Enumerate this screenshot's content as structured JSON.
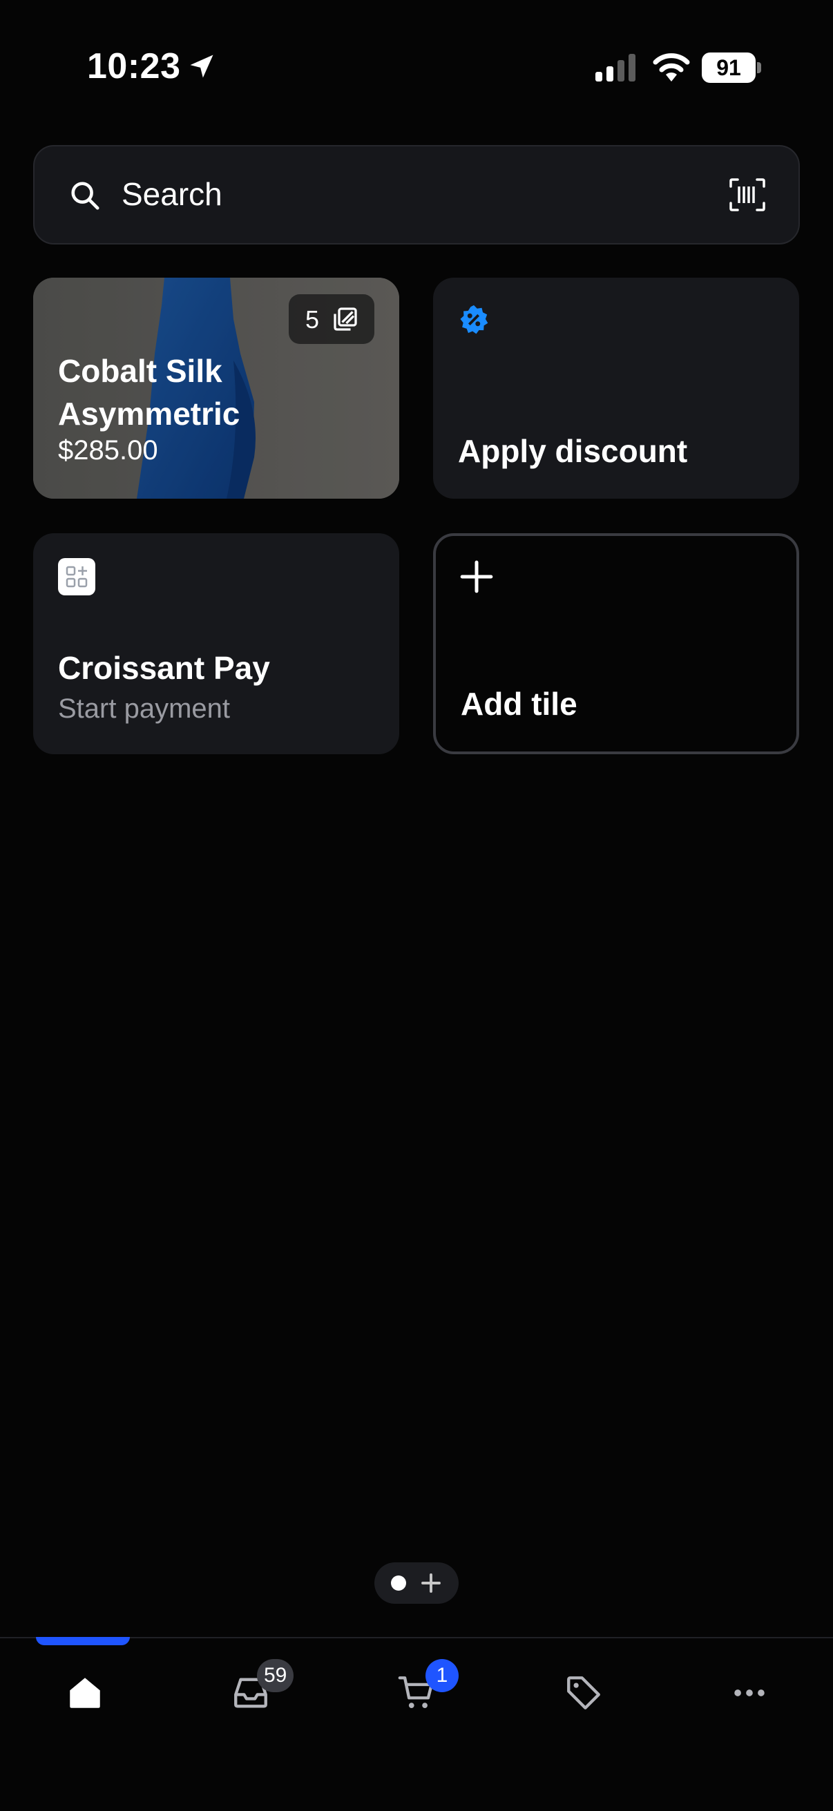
{
  "status_bar": {
    "time": "10:23",
    "battery": "91"
  },
  "search": {
    "placeholder": "Search"
  },
  "tiles": {
    "product": {
      "name": "Cobalt Silk Asymmetric",
      "price": "$285.00",
      "image_count": "5"
    },
    "discount": {
      "title": "Apply discount"
    },
    "app": {
      "title": "Croissant Pay",
      "subtitle": "Start payment"
    },
    "add": {
      "title": "Add tile"
    }
  },
  "tabbar": {
    "inbox_badge": "59",
    "cart_badge": "1"
  },
  "colors": {
    "accent": "#1f55ff",
    "discount_icon": "#1a8cff",
    "background": "#050505",
    "tile": "#17181c"
  },
  "icons": [
    "location-arrow-icon",
    "signal-icon",
    "wifi-icon",
    "search-icon",
    "barcode-scan-icon",
    "images-icon",
    "discount-badge-icon",
    "app-grid-icon",
    "plus-icon",
    "home-icon",
    "inbox-icon",
    "cart-icon",
    "tag-icon",
    "more-icon"
  ]
}
